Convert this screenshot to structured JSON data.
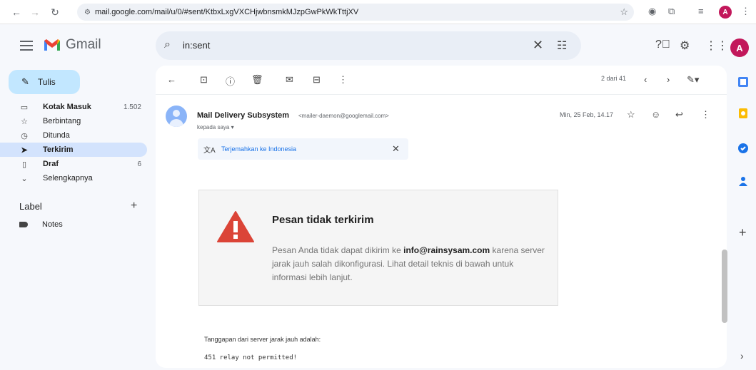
{
  "browser": {
    "url": "mail.google.com/mail/u/0/#sent/KtbxLxgVXCHjwbnsmkMJzpGwPkWkTttjXV",
    "profile_initial": "A"
  },
  "header": {
    "app_name": "Gmail",
    "search_query": "in:sent",
    "avatar_initial": "A"
  },
  "sidebar": {
    "compose_label": "Tulis",
    "items": [
      {
        "label": "Kotak Masuk",
        "count": "1.502",
        "icon": "inbox-icon"
      },
      {
        "label": "Berbintang",
        "count": "",
        "icon": "star-icon"
      },
      {
        "label": "Ditunda",
        "count": "",
        "icon": "clock-icon"
      },
      {
        "label": "Terkirim",
        "count": "",
        "icon": "send-icon"
      },
      {
        "label": "Draf",
        "count": "6",
        "icon": "draft-icon"
      },
      {
        "label": "Selengkapnya",
        "count": "",
        "icon": "chevron-down-icon"
      }
    ],
    "labels_heading": "Label",
    "labels": [
      {
        "label": "Notes"
      }
    ]
  },
  "toolbar": {
    "pager_text": "2 dari 41"
  },
  "message": {
    "sender_name": "Mail Delivery Subsystem",
    "sender_email": "<mailer-daemon@googlemail.com>",
    "to_line": "kepada saya",
    "date": "Min, 25 Feb, 14.17",
    "translate_text": "Terjemahkan ke Indonesia",
    "bounce_title": "Pesan tidak terkirim",
    "bounce_text_before": "Pesan Anda tidak dapat dikirim ke ",
    "bounce_email": "info@rainsysam.com",
    "bounce_text_after": " karena server jarak jauh salah dikonfigurasi. Lihat detail teknis di bawah untuk informasi lebih lanjut.",
    "server_response_label": "Tanggapan dari server jarak jauh adalah:",
    "server_response_code": "451 relay not permitted!"
  },
  "colors": {
    "accent": "#c2e7ff",
    "active_nav": "#d3e3fd",
    "warning_red": "#db4437",
    "link_blue": "#1a73e8"
  }
}
